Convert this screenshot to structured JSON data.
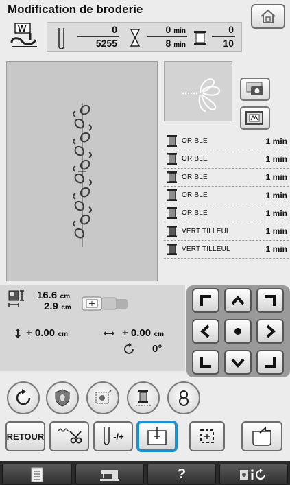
{
  "header": {
    "title": "Modification de broderie"
  },
  "stats": {
    "stitch_current": "0",
    "stitch_total": "5255",
    "time_current": "0",
    "time_total": "8",
    "time_unit": "min",
    "color_current": "0",
    "color_total": "10"
  },
  "threads": [
    {
      "name": "OR BLE",
      "time": "1 min",
      "color": "#8c8c8c"
    },
    {
      "name": "OR BLE",
      "time": "1 min",
      "color": "#8c8c8c"
    },
    {
      "name": "OR BLE",
      "time": "1 min",
      "color": "#8c8c8c"
    },
    {
      "name": "OR BLE",
      "time": "1 min",
      "color": "#8c8c8c"
    },
    {
      "name": "OR BLE",
      "time": "1 min",
      "color": "#8c8c8c"
    },
    {
      "name": "VERT TILLEUL",
      "time": "1 min",
      "color": "#5a5a5a"
    },
    {
      "name": "VERT TILLEUL",
      "time": "1 min",
      "color": "#5a5a5a"
    }
  ],
  "size": {
    "width": "16.6",
    "height": "2.9",
    "unit": "cm"
  },
  "position": {
    "vertical": "+ 0.00",
    "horizontal": "+ 0.00",
    "unit": "cm",
    "angle": "0°"
  },
  "toolbar": {
    "back_label": "RETOUR",
    "needle_bar_label": "-/+"
  },
  "footer": {
    "help_label": "?"
  },
  "colors": {
    "accent": "#1a8fd6"
  }
}
